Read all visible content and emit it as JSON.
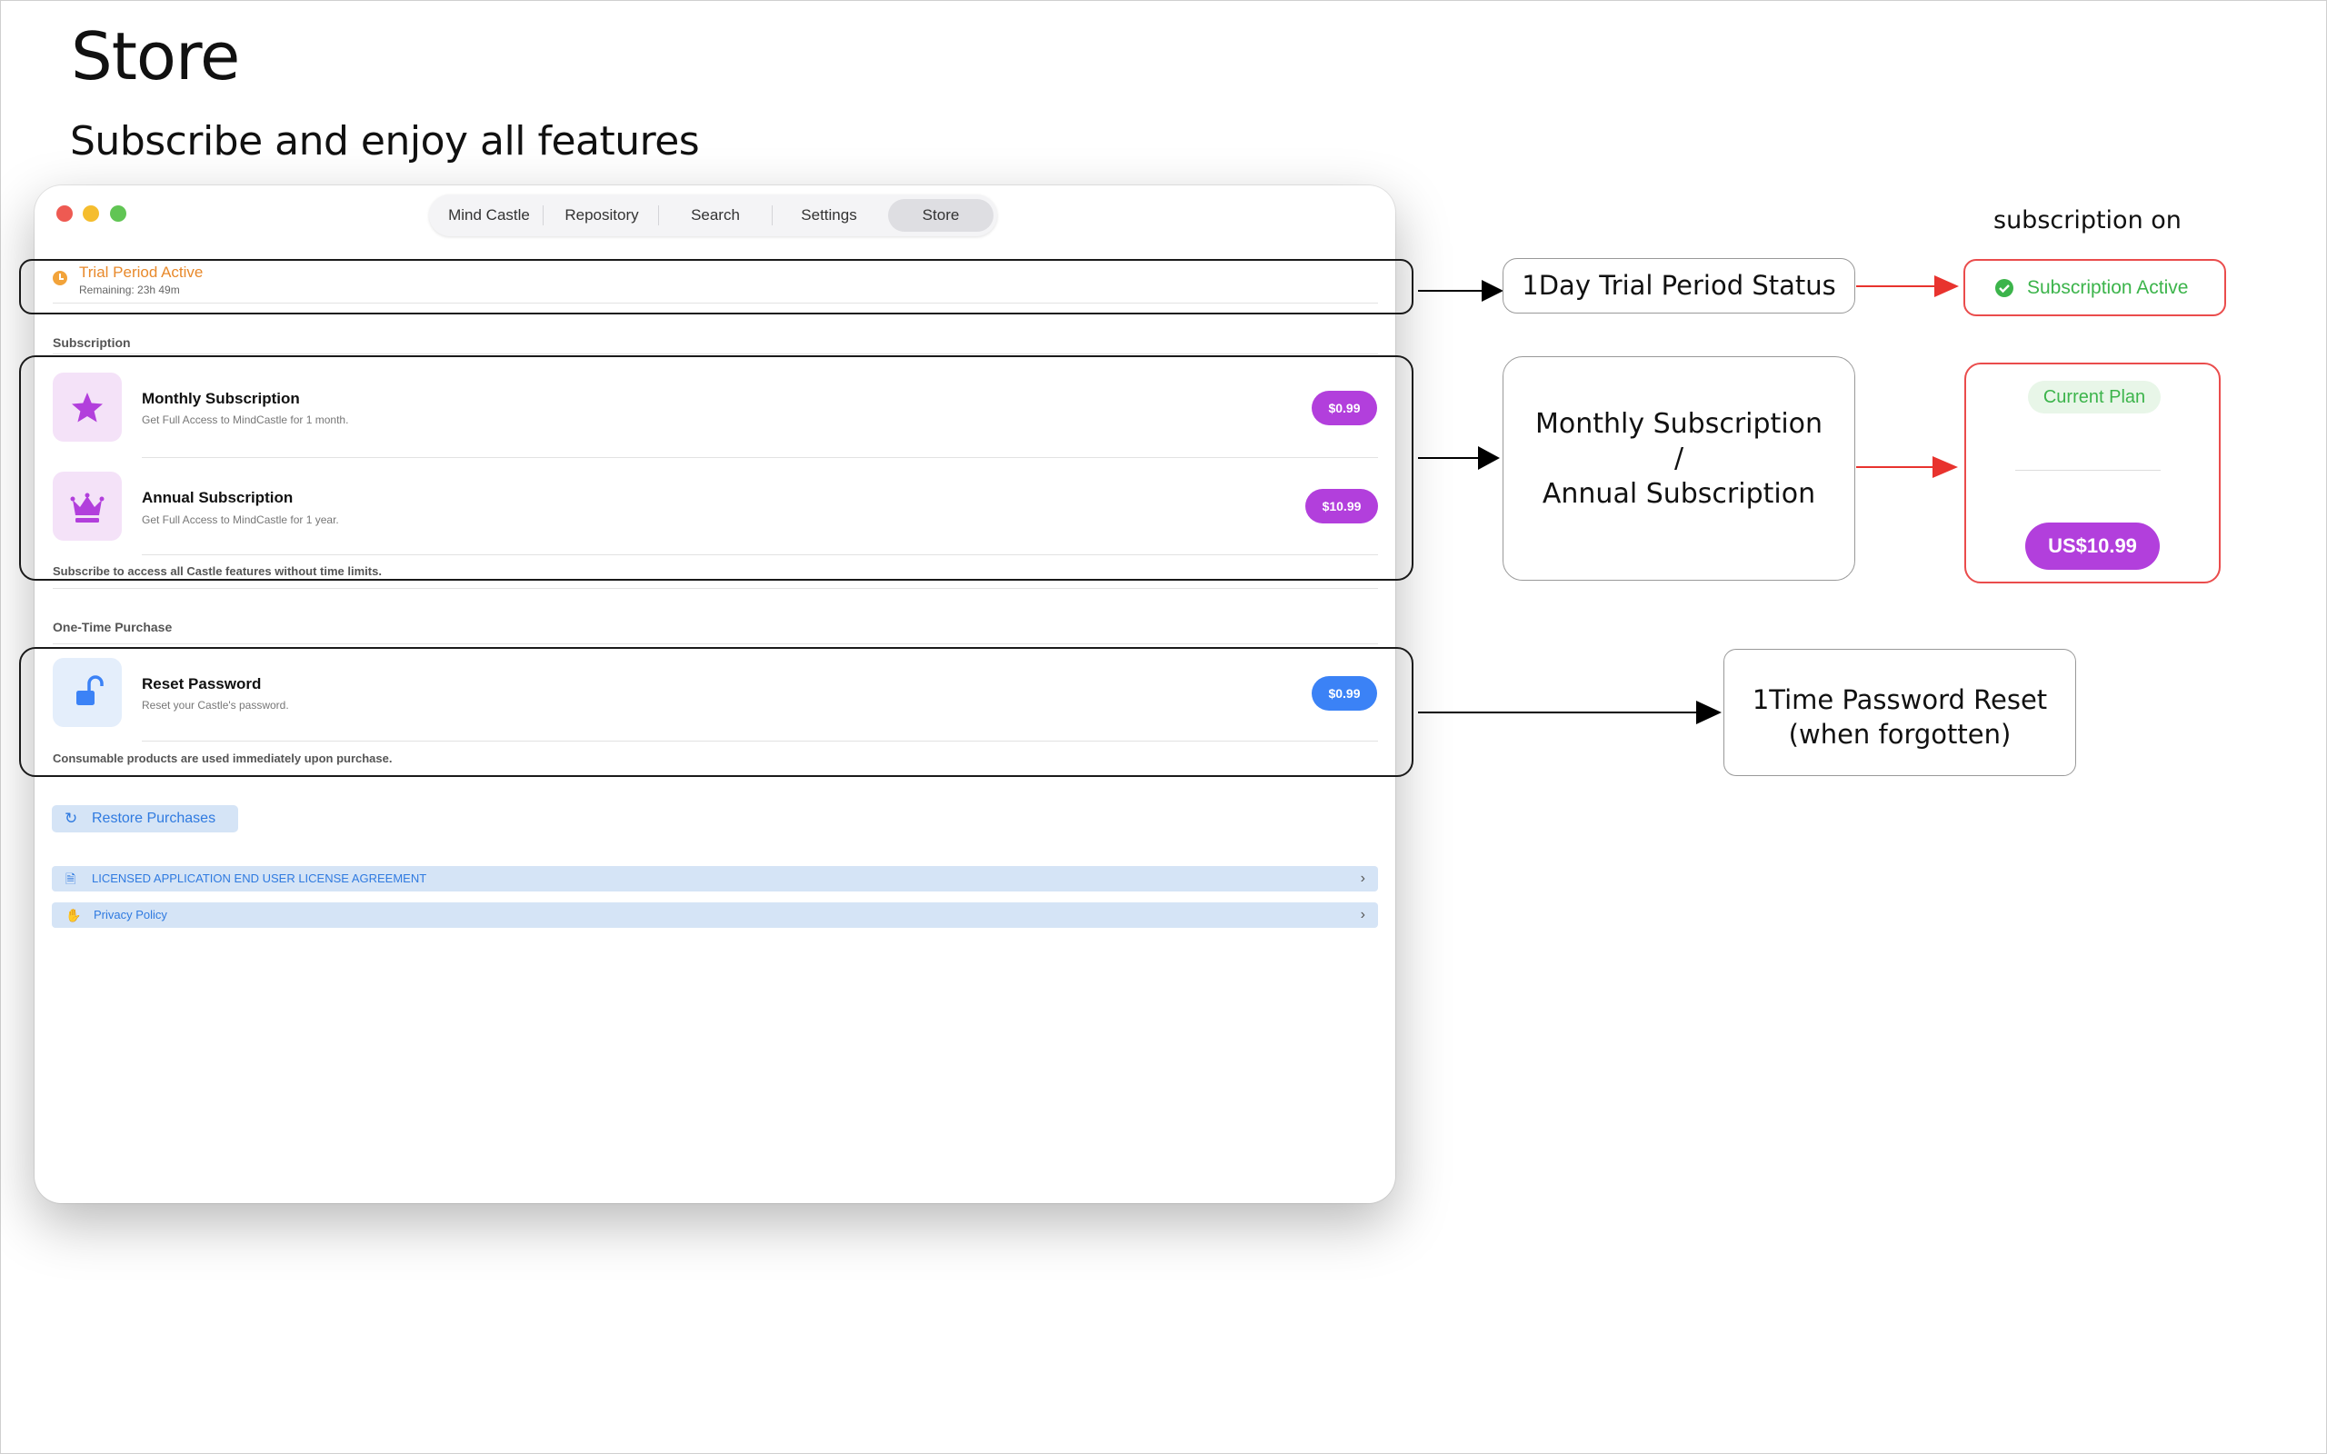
{
  "page": {
    "title": "Store",
    "subtitle": "Subscribe and enjoy all features"
  },
  "window": {
    "tabs": [
      {
        "label": "Mind Castle"
      },
      {
        "label": "Repository"
      },
      {
        "label": "Search"
      },
      {
        "label": "Settings"
      },
      {
        "label": "Store"
      }
    ],
    "trial": {
      "title": "Trial Period Active",
      "remaining": "Remaining: 23h 49m"
    },
    "subscription": {
      "section_label": "Subscription",
      "items": [
        {
          "title": "Monthly Subscription",
          "desc": "Get Full Access to MindCastle for 1 month.",
          "price": "$0.99",
          "icon": "star-icon"
        },
        {
          "title": "Annual Subscription",
          "desc": "Get Full Access to MindCastle for 1 year.",
          "price": "$10.99",
          "icon": "crown-icon"
        }
      ],
      "footer": "Subscribe to access all Castle features without time limits."
    },
    "one_time": {
      "section_label": "One-Time Purchase",
      "items": [
        {
          "title": "Reset Password",
          "desc": "Reset your Castle's password.",
          "price": "$0.99",
          "icon": "unlock-icon"
        }
      ],
      "footer": "Consumable products are used immediately upon purchase."
    },
    "restore_label": "Restore Purchases",
    "links": [
      {
        "label": "LICENSED APPLICATION END USER LICENSE AGREEMENT",
        "icon": "document-icon"
      },
      {
        "label": "Privacy Policy",
        "icon": "hand-icon"
      }
    ]
  },
  "annotations": {
    "trial_status": "1Day Trial Period Status",
    "subscription_on_label": "subscription on",
    "subscription_active": "Subscription Active",
    "sub_types": {
      "line1": "Monthly Subscription",
      "line2": "/",
      "line3": "Annual Subscription"
    },
    "current_plan": "Current Plan",
    "current_price": "US$10.99",
    "password_reset": {
      "line1": "1Time Password Reset",
      "line2": "(when forgotten)"
    }
  },
  "colors": {
    "purple": "#b23fdc",
    "blue": "#3b82f6",
    "orange": "#e8892b",
    "green": "#3cb44b",
    "red": "#ea4c4c"
  }
}
